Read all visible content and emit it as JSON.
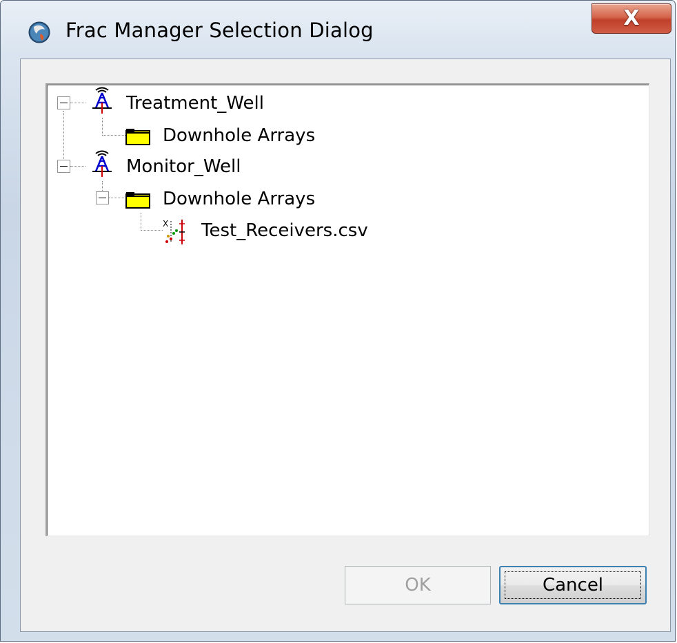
{
  "window": {
    "title": "Frac Manager Selection Dialog",
    "title_icon": "app-globe-icon",
    "close_glyph": "X"
  },
  "tree": {
    "nodes": [
      {
        "label": "Treatment_Well",
        "icon": "well-tower-icon",
        "expanded": true
      },
      {
        "label": "Downhole Arrays",
        "icon": "folder-icon"
      },
      {
        "label": "Monitor_Well",
        "icon": "well-tower-icon",
        "expanded": true
      },
      {
        "label": "Downhole Arrays",
        "icon": "folder-icon",
        "expanded": true
      },
      {
        "label": "Test_Receivers.csv",
        "icon": "receiver-array-icon"
      }
    ]
  },
  "buttons": {
    "ok_label": "OK",
    "ok_enabled": false,
    "cancel_label": "Cancel"
  },
  "colors": {
    "close_button": "#c0402a",
    "folder_fill": "#ffff00",
    "tower_blue": "#0000cc",
    "tower_red": "#cc0000",
    "focus_border": "#3c7fb1"
  }
}
